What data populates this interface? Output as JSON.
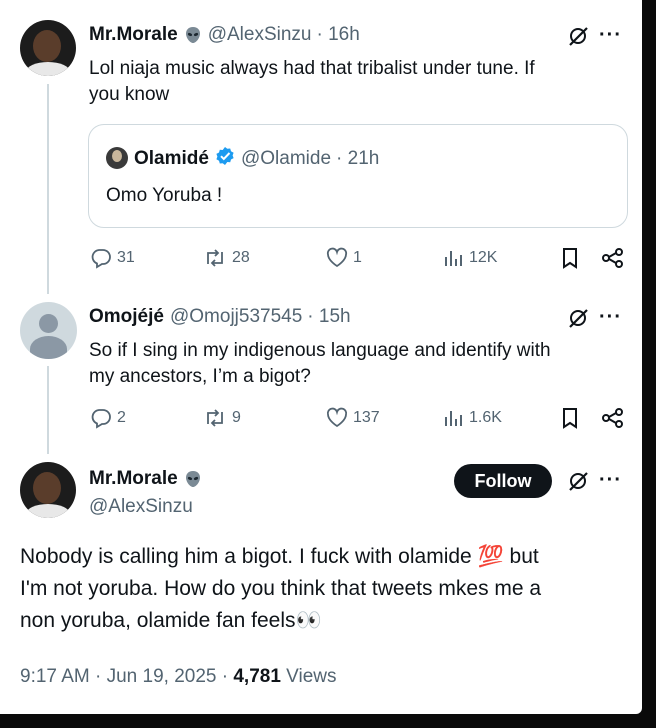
{
  "tweet1": {
    "name": "Mr.Morale",
    "handle": "@AlexSinzu",
    "time": "· 16h",
    "text_line1": "Lol niaja music always had that tribalist under tune. If",
    "text_line2": "you know",
    "quote": {
      "name": "Olamidé",
      "handle": "@Olamide",
      "time": "· 21h",
      "text": "Omo Yoruba !"
    },
    "replies": "31",
    "reposts": "28",
    "likes": "1",
    "views": "12K"
  },
  "tweet2": {
    "name": "Omojéjé",
    "handle": "@Omojj537545",
    "time": "· 15h",
    "text_line1": "So if I sing in my indigenous language and identify with",
    "text_line2": "my ancestors, I’m a bigot?",
    "replies": "2",
    "reposts": "9",
    "likes": "137",
    "views": "1.6K"
  },
  "main": {
    "name": "Mr.Morale",
    "handle": "@AlexSinzu",
    "follow_label": "Follow",
    "text_line1": "Nobody is calling him a bigot. I fuck with olamide 💯 but",
    "text_line2": "I'm not yoruba. How do you think that tweets mkes me a",
    "text_line3": "non yoruba, olamide fan feels👀",
    "date": "9:17 AM · Jun 19, 2025 · ",
    "views_count": "4,781",
    "views_label": " Views"
  },
  "more_glyph": "···",
  "colors": {
    "accent": "#1d9bf0",
    "muted": "#536471",
    "text": "#0f1419",
    "border": "#cfd9de"
  },
  "icons": [
    "alien-icon",
    "grok-icon",
    "more-icon",
    "verified-icon",
    "reply-icon",
    "repost-icon",
    "like-icon",
    "views-icon",
    "bookmark-icon",
    "share-icon"
  ]
}
